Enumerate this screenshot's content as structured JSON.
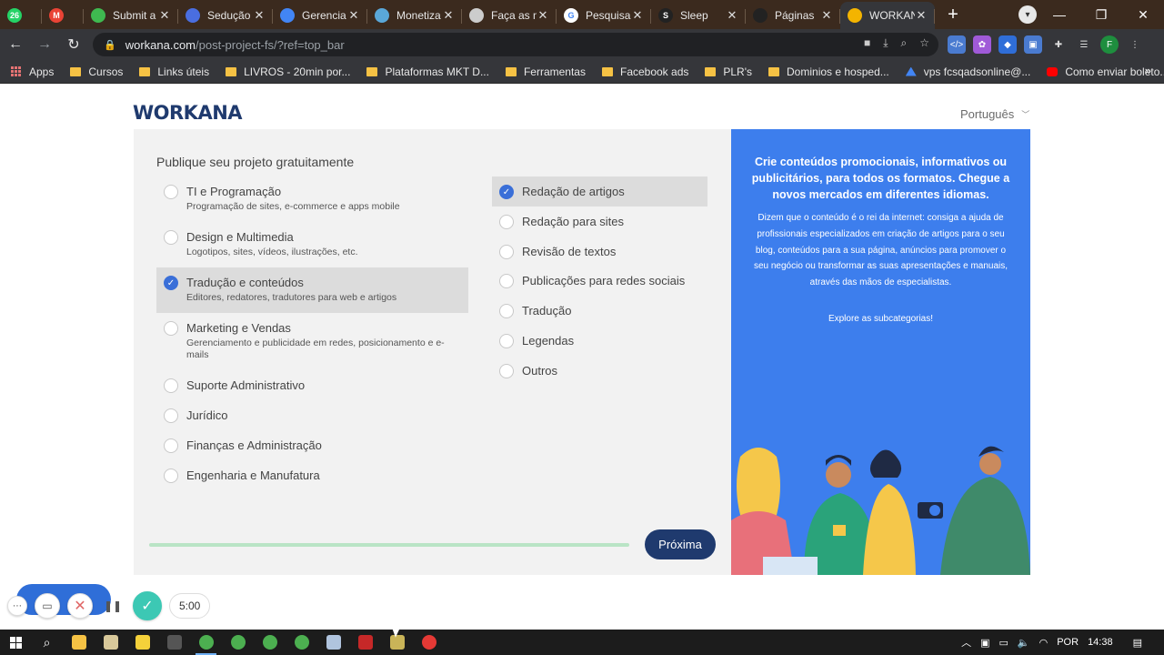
{
  "browser": {
    "tabs": [
      {
        "title": "",
        "icon": "whatsapp-icon",
        "color": "#25d366",
        "badge": "26"
      },
      {
        "title": "",
        "icon": "gmail-icon",
        "color": "#ea4335",
        "badge": "M"
      },
      {
        "title": "Submit a",
        "icon": "leaf-icon",
        "color": "#3fb950",
        "badge": ""
      },
      {
        "title": "Sedução",
        "icon": "badge-icon",
        "color": "#4a6ee0",
        "badge": ""
      },
      {
        "title": "Gerencia",
        "icon": "diamond-icon",
        "color": "#4285f4",
        "badge": ""
      },
      {
        "title": "Monetiza",
        "icon": "gear-icon",
        "color": "#5aa7d8",
        "badge": ""
      },
      {
        "title": "Faça as m",
        "icon": "globe-icon",
        "color": "#cccccc",
        "badge": ""
      },
      {
        "title": "Pesquisa",
        "icon": "google-icon",
        "color": "#ffffff",
        "badge": "G"
      },
      {
        "title": "Sleep",
        "icon": "s-icon",
        "color": "#222222",
        "badge": "S"
      },
      {
        "title": "Páginas",
        "icon": "page-icon",
        "color": "#222222",
        "badge": ""
      },
      {
        "title": "WORKAN",
        "icon": "workana-icon",
        "color": "#f4b400",
        "badge": ""
      }
    ],
    "url_host": "workana.com",
    "url_path": "/post-project-fs/?ref=top_bar",
    "profile_letter": "F",
    "bookmarks": [
      {
        "label": "Apps",
        "type": "apps"
      },
      {
        "label": "Cursos",
        "type": "folder"
      },
      {
        "label": "Links úteis",
        "type": "folder"
      },
      {
        "label": "LIVROS - 20min por...",
        "type": "folder"
      },
      {
        "label": "Plataformas MKT D...",
        "type": "folder"
      },
      {
        "label": "Ferramentas",
        "type": "folder"
      },
      {
        "label": "Facebook ads",
        "type": "folder"
      },
      {
        "label": "PLR's",
        "type": "folder"
      },
      {
        "label": "Dominios e hosped...",
        "type": "folder"
      },
      {
        "label": "vps fcsqadsonline@...",
        "type": "drive"
      },
      {
        "label": "Como enviar boleto...",
        "type": "youtube"
      }
    ]
  },
  "page": {
    "logo": "WORKANA",
    "language": "Português",
    "form_title": "Publique seu projeto gratuitamente",
    "categories": [
      {
        "label": "TI e Programação",
        "desc": "Programação de sites, e-commerce e apps mobile",
        "selected": false
      },
      {
        "label": "Design e Multimedia",
        "desc": "Logotipos, sites, vídeos, ilustrações, etc.",
        "selected": false
      },
      {
        "label": "Tradução e conteúdos",
        "desc": "Editores, redatores, tradutores para web e artigos",
        "selected": true
      },
      {
        "label": "Marketing e Vendas",
        "desc": "Gerenciamento e publicidade em redes, posicionamento e e-mails",
        "selected": false
      },
      {
        "label": "Suporte Administrativo",
        "desc": "",
        "selected": false
      },
      {
        "label": "Jurídico",
        "desc": "",
        "selected": false
      },
      {
        "label": "Finanças e Administração",
        "desc": "",
        "selected": false
      },
      {
        "label": "Engenharia e Manufatura",
        "desc": "",
        "selected": false
      }
    ],
    "subcategories": [
      {
        "label": "Redação de artigos",
        "selected": true
      },
      {
        "label": "Redação para sites",
        "selected": false
      },
      {
        "label": "Revisão de textos",
        "selected": false
      },
      {
        "label": "Publicações para redes sociais",
        "selected": false
      },
      {
        "label": "Tradução",
        "selected": false
      },
      {
        "label": "Legendas",
        "selected": false
      },
      {
        "label": "Outros",
        "selected": false
      }
    ],
    "next_label": "Próxima",
    "promo_heading": "Crie conteúdos promocionais, informativos ou publicitários, para todos os formatos. Chegue a novos mercados em diferentes idiomas.",
    "promo_body": "Dizem que o conteúdo é o rei da internet: consiga a ajuda de profissionais especializados em criação de artigos para o seu blog, conteúdos para a sua página, anúncios para promover o seu negócio ou transformar as suas apresentações e manuais, através das mãos de especialistas.",
    "promo_link": "Explore as subcategorias!",
    "colors": {
      "brand": "#1f3a6e",
      "accent": "#3d7eed",
      "check": "#3a6fd8"
    }
  },
  "recorder": {
    "timer": "5:00"
  },
  "taskbar": {
    "language": "POR",
    "time": "14:38"
  }
}
